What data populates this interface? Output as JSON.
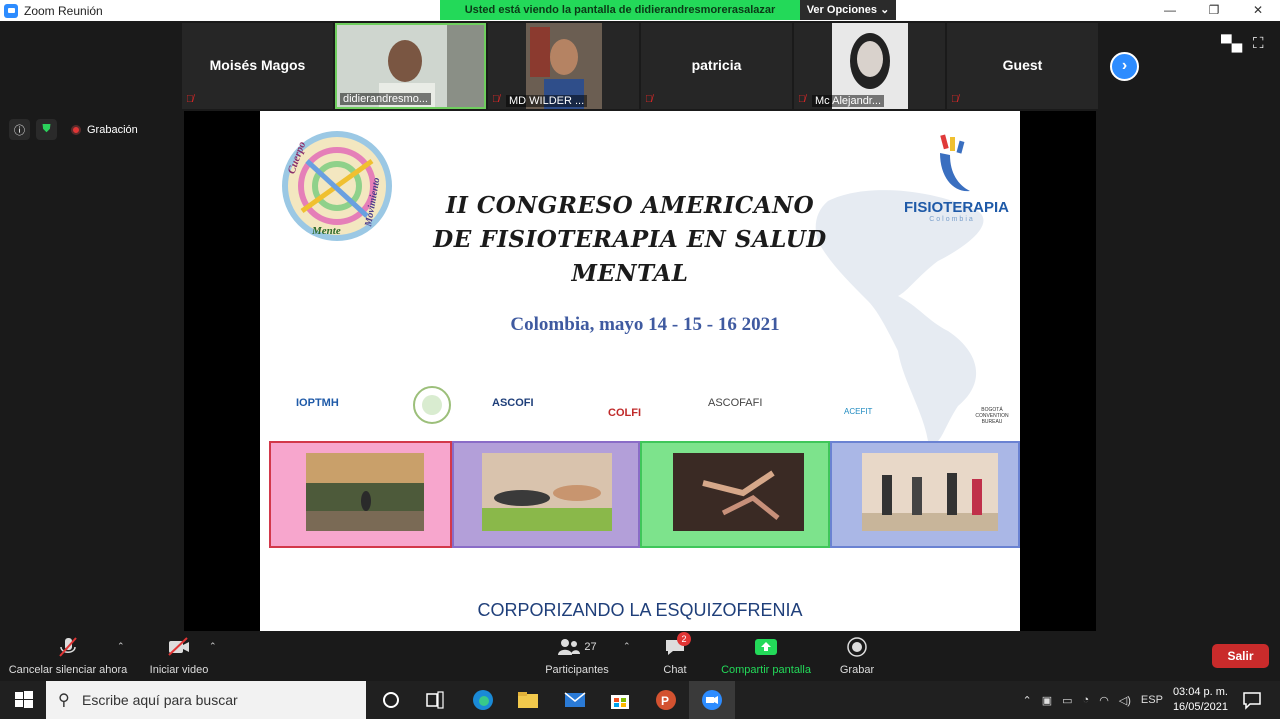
{
  "window": {
    "title": "Zoom Reunión",
    "controls": [
      "—",
      "❐",
      "✕"
    ]
  },
  "share_banner": {
    "message": "Usted está viendo la pantalla de didierandresmorerasalazar",
    "options_label": "Ver Opciones ⌄"
  },
  "participants": [
    {
      "name": "Moisés Magos",
      "label": ""
    },
    {
      "name": "",
      "label": "didierandresmo..."
    },
    {
      "name": "",
      "label": "MD WILDER ..."
    },
    {
      "name": "patricia",
      "label": ""
    },
    {
      "name": "",
      "label": "Mc Alejandr..."
    },
    {
      "name": "Guest",
      "label": ""
    }
  ],
  "recording": {
    "label": "Grabación"
  },
  "slide": {
    "title": "II Congreso Americano de Fisioterapia en Salud Mental",
    "title_lines": [
      "II CONGRESO AMERICANO",
      "DE FISIOTERAPIA EN SALUD",
      "MENTAL"
    ],
    "subtitle": "Colombia, mayo 14 - 15 - 16 2021",
    "fisio_logo": "FISIOTERAPIA",
    "fisio_sub": "Colombia",
    "logo_words": [
      "Cuerpo",
      "Mente",
      "Movimiento"
    ],
    "orgs": [
      "IOPTMH",
      "ASCOFI",
      "COLFI",
      "ASCOFAFI",
      "ACEFIT",
      "BOGOTÁ CONVENTION BUREAU"
    ],
    "footer": "CORPORIZANDO LA ESQUIZOFRENIA"
  },
  "toolbar": {
    "mute": "Cancelar silenciar ahora",
    "video": "Iniciar video",
    "participants": "Participantes",
    "participants_count": "27",
    "chat": "Chat",
    "chat_badge": "2",
    "share": "Compartir pantalla",
    "record": "Grabar",
    "leave": "Salir"
  },
  "taskbar": {
    "search_placeholder": "Escribe aquí para buscar",
    "lang": "ESP",
    "time": "03:04 p. m.",
    "date": "16/05/2021"
  },
  "colors": {
    "accent": "#2d8cff",
    "share_green": "#23d959",
    "leave_red": "#c92b2b"
  }
}
